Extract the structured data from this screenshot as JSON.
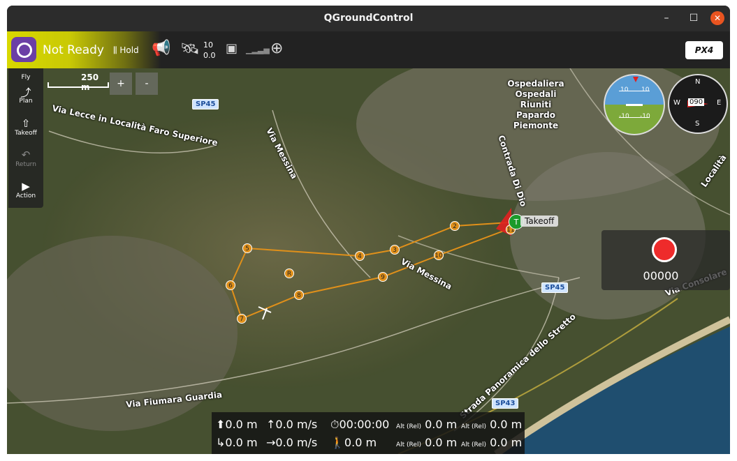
{
  "window": {
    "title": "QGroundControl",
    "controls": {
      "minimize": "–",
      "maximize": "☐",
      "close": "✕"
    }
  },
  "toolbar": {
    "status": "Not Ready",
    "flight_mode": "Hold",
    "satellites": "10",
    "hdop": "0.0",
    "brand": "PX4"
  },
  "left_tools": [
    {
      "label": "Fly",
      "icon": "paper-plane-icon"
    },
    {
      "label": "Plan",
      "icon": "plan-route-icon"
    },
    {
      "label": "Takeoff",
      "icon": "takeoff-icon"
    },
    {
      "label": "Return",
      "icon": "return-icon"
    },
    {
      "label": "Action",
      "icon": "action-play-icon"
    }
  ],
  "map": {
    "scale": "250 m",
    "zoom_in": "+",
    "zoom_out": "-",
    "labels": {
      "road_sp45_a": "SP45",
      "road_sp45_b": "SP45",
      "road_sp43": "SP43",
      "via_lecce": "Via Lecce in Località Faro Superiore",
      "via_messina_1": "Via Messina",
      "via_messina_2": "Via Messina",
      "contrada": "Contrada Di Dio",
      "hospital": "Ospedaliera Ospedali Riuniti Papardo Piemonte",
      "strada_panoramica": "Strada Panoramica dello Stretto",
      "via_fiumara": "Via Fiumara Guardia",
      "via_consolare": "Via Consolare",
      "localita": "Località"
    },
    "takeoff_label": "Takeoff",
    "takeoff_marker": "T",
    "waypoints": [
      "2",
      "3",
      "4",
      "5",
      "6",
      "7",
      "8",
      "9",
      "10",
      "11",
      "R"
    ]
  },
  "instruments": {
    "attitude_ticks": [
      "10",
      "10",
      "-10",
      "-10"
    ],
    "compass": {
      "heading": "090",
      "n": "N",
      "e": "E",
      "s": "S",
      "w": "W"
    }
  },
  "video": {
    "record_time": "00000"
  },
  "telemetry": {
    "altitude": "0.0 m",
    "climb_rate": "0.0 m/s",
    "flight_time": "00:00:00",
    "alt_rel_1": "0.0 m",
    "alt_rel_2": "0.0 m",
    "distance": "0.0 m",
    "ground_speed": "0.0 m/s",
    "dist_home": "0.0 m",
    "alt_rel_3": "0.0 m",
    "alt_rel_4": "0.0 m",
    "alt_rel_label": "Alt (Rel)"
  }
}
